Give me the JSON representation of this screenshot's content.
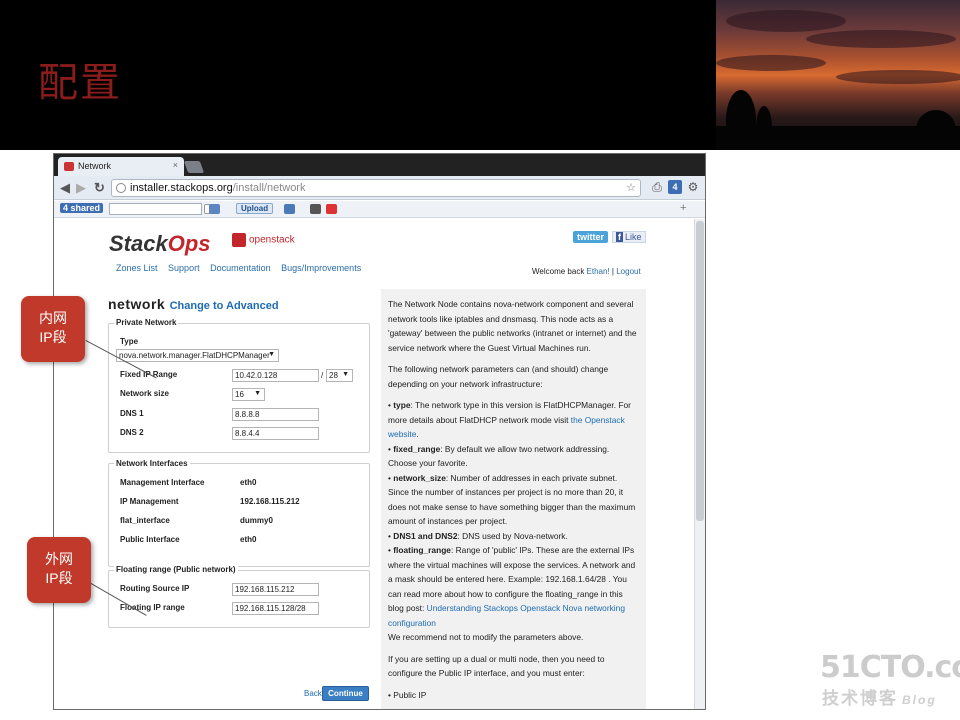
{
  "slide": {
    "title": "配置",
    "watermark": "51CTO.com",
    "watermark_sub": "技术博客",
    "watermark_blog": "Blog"
  },
  "browser": {
    "tab_title": "Network",
    "url_domain": "installer.stackops.org",
    "url_path": "/install/network",
    "toolbar": {
      "logo": "4 shared",
      "upload_label": "Upload"
    }
  },
  "site": {
    "logo_main": "Stack",
    "logo_accent": "Ops",
    "partner_logo": "openstack",
    "twitter_label": "twitter",
    "like_label": "Like",
    "nav": [
      "Zones List",
      "Support",
      "Documentation",
      "Bugs/Improvements"
    ],
    "welcome_prefix": "Welcome back ",
    "welcome_user": "Ethan!",
    "welcome_sep": " | ",
    "logout": "Logout"
  },
  "form": {
    "heading": "network",
    "advanced_link": "Change to Advanced",
    "private": {
      "legend": "Private Network",
      "type_label": "Type",
      "type_value": "nova.network.manager.FlatDHCPManager",
      "fixed_label": "Fixed IP Range",
      "fixed_value": "10.42.0.128",
      "fixed_slash": "/",
      "fixed_mask": "28",
      "size_label": "Network size",
      "size_value": "16",
      "dns1_label": "DNS 1",
      "dns1_value": "8.8.8.8",
      "dns2_label": "DNS 2",
      "dns2_value": "8.8.4.4"
    },
    "interfaces": {
      "legend": "Network Interfaces",
      "rows": [
        {
          "label": "Management Interface",
          "value": "eth0"
        },
        {
          "label": "IP Management",
          "value": "192.168.115.212"
        },
        {
          "label": "flat_interface",
          "value": "dummy0"
        },
        {
          "label": "Public Interface",
          "value": "eth0"
        }
      ]
    },
    "floating": {
      "legend": "Floating range (Public network)",
      "routing_label": "Routing Source IP",
      "routing_value": "192.168.115.212",
      "range_label": "Floating IP range",
      "range_value": "192.168.115.128/28"
    },
    "back_label": "Back",
    "continue_label": "Continue"
  },
  "help": {
    "p1": "The Network Node contains nova-network component and several network tools like iptables and dnsmasq. This node acts as a 'gateway' between the public networks (intranet or internet) and the service network where the Guest Virtual Machines run.",
    "p2": "The following network parameters can (and should) change depending on your network infrastructure:",
    "type_key": "type",
    "type_text": ": The network type in this version is FlatDHCPManager. For more details about FlatDHCP network mode visit ",
    "type_link": "the Openstack website",
    "type_end": ".",
    "fixed_key": "fixed_range",
    "fixed_text": ": By default we allow two network addressing. Choose your favorite.",
    "size_key": "network_size",
    "size_text": ": Number of addresses in each private subnet. Since the number of instances per project is no more than 20, it does not make sense to have something bigger than the maximum amount of instances per project.",
    "dns_key": "DNS1 and DNS2",
    "dns_text": ": DNS used by Nova-network.",
    "float_key": "floating_range",
    "float_text": ": Range of 'public' IPs. These are the external IPs where the virtual machines will expose the services. A network and a mask should be entered here. Example: 192.168.1.64/28 . You can read more about how to configure the floating_range in this blog post: ",
    "float_link": "Understanding Stackops Openstack Nova networking configuration",
    "float_end": "We recommend not to modify the parameters above.",
    "p_multi": "If you are setting up a dual or multi node, then you need to configure the Public IP interface, and you must enter:",
    "public_ip": "Public IP"
  },
  "callouts": {
    "internal": "内网\nIP段",
    "external": "外网\nIP段"
  }
}
